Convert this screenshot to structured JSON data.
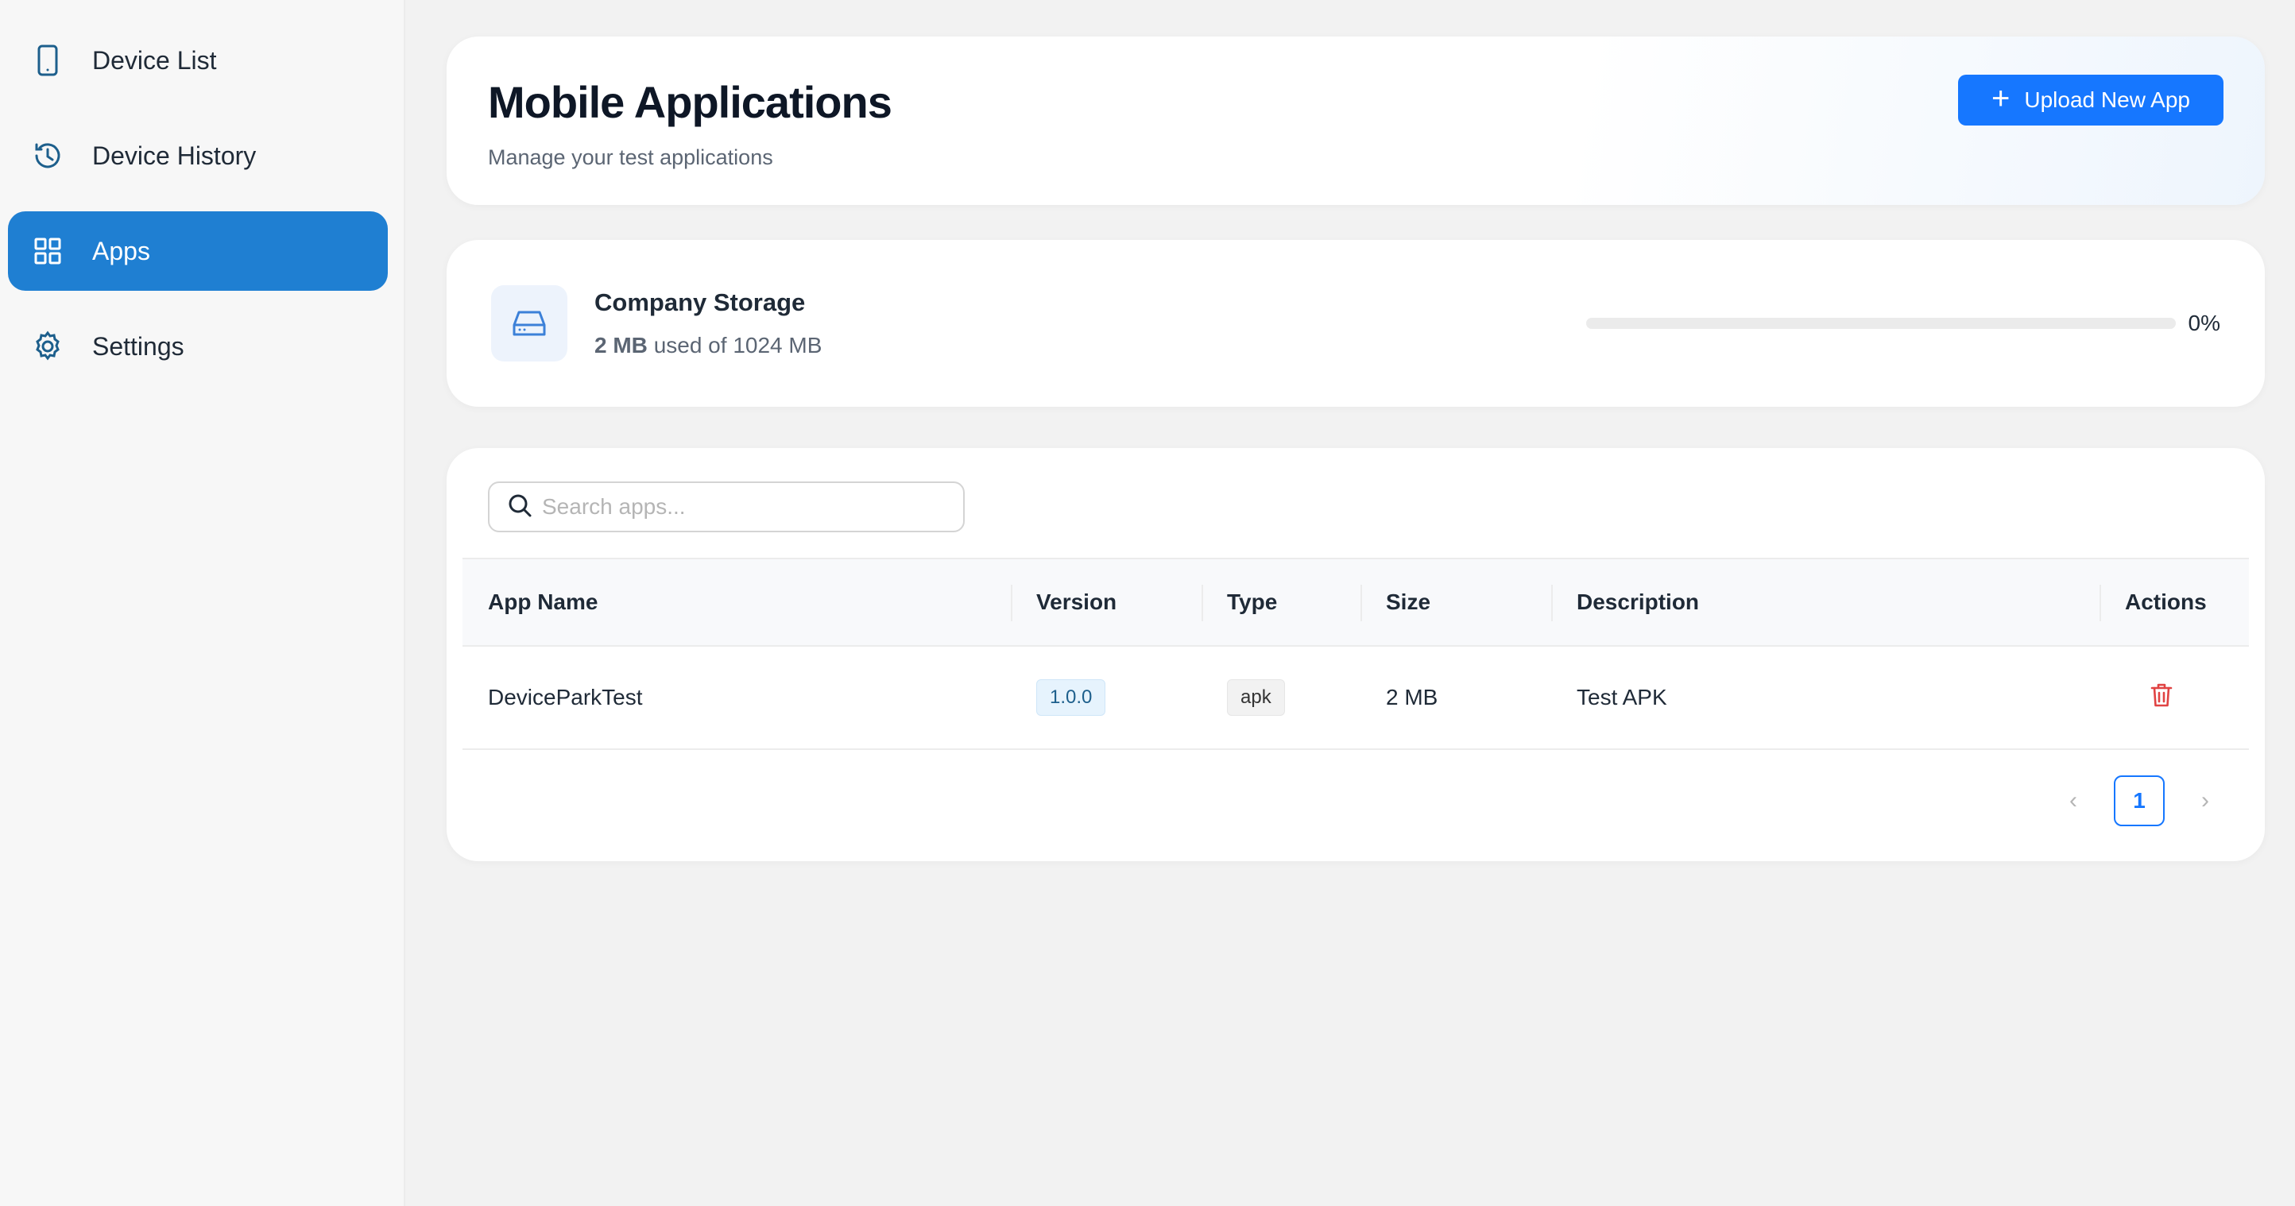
{
  "sidebar": {
    "items": [
      {
        "label": "Device List",
        "icon": "phone-icon",
        "active": false
      },
      {
        "label": "Device History",
        "icon": "history-icon",
        "active": false
      },
      {
        "label": "Apps",
        "icon": "grid-icon",
        "active": true
      },
      {
        "label": "Settings",
        "icon": "gear-icon",
        "active": false
      }
    ]
  },
  "header": {
    "title": "Mobile Applications",
    "subtitle": "Manage your test applications",
    "upload_label": "Upload New App"
  },
  "storage": {
    "title": "Company Storage",
    "used": "2 MB",
    "used_suffix": "used of 1024 MB",
    "percent_label": "0%",
    "percent": 0
  },
  "search": {
    "placeholder": "Search apps...",
    "value": ""
  },
  "table": {
    "columns": [
      "App Name",
      "Version",
      "Type",
      "Size",
      "Description",
      "Actions"
    ],
    "rows": [
      {
        "name": "DeviceParkTest",
        "version": "1.0.0",
        "type": "apk",
        "size": "2 MB",
        "description": "Test APK"
      }
    ]
  },
  "pagination": {
    "current_page": "1"
  },
  "colors": {
    "accent": "#1677ff",
    "sidebar_active": "#1f7fd2",
    "danger": "#e04343"
  }
}
